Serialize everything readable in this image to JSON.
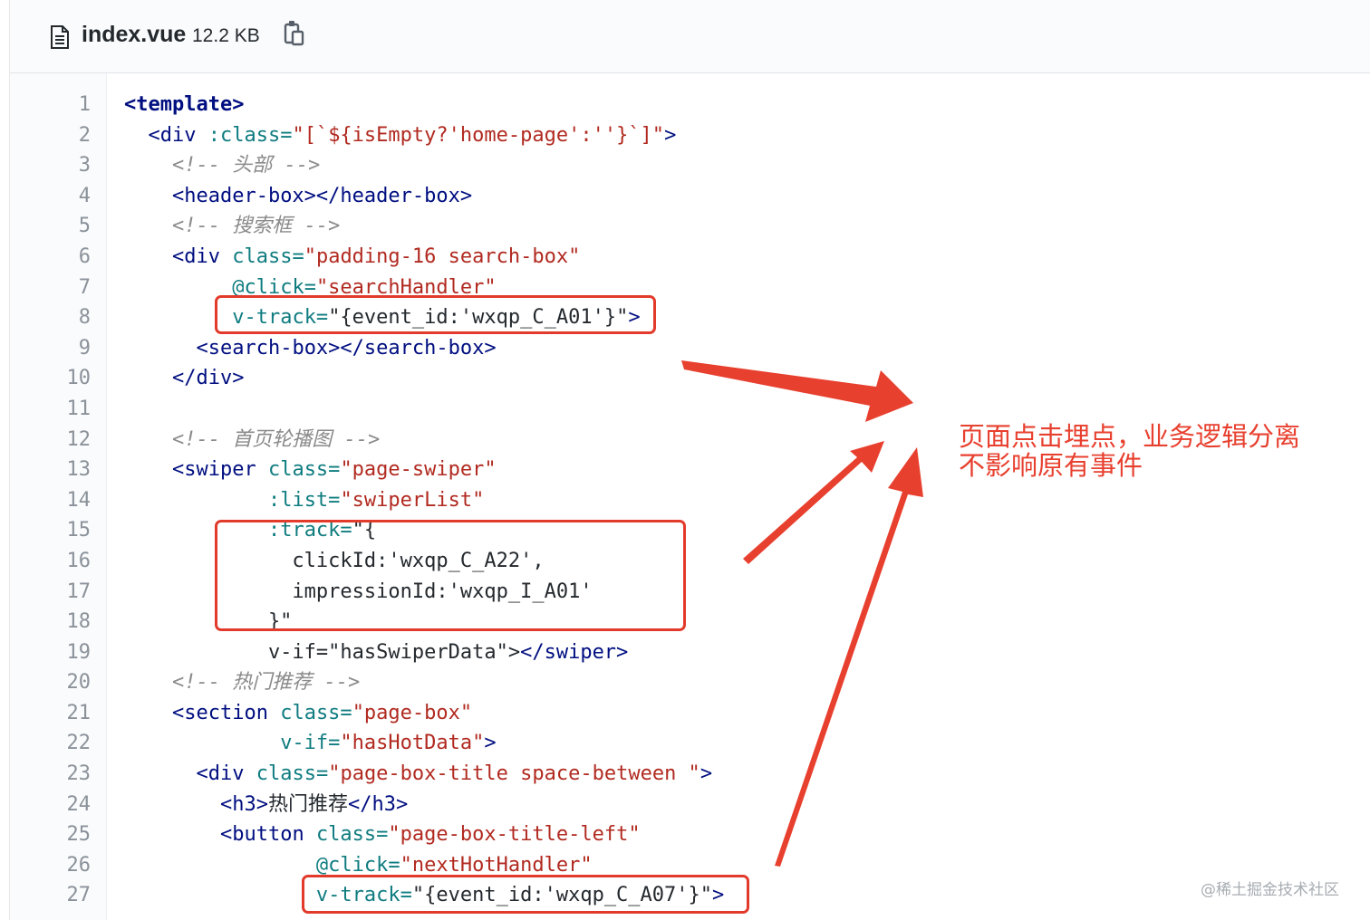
{
  "file_header": {
    "file_name": "index.vue",
    "file_size": "12.2 KB",
    "file_icon": "file-text-icon",
    "copy_icon": "clipboard-copy-icon"
  },
  "colors": {
    "tag": "#000e80",
    "attribute": "#0f7c80",
    "string": "#b12a20",
    "comment": "#8a8a8a",
    "highlight": "#e23a2b"
  },
  "code": {
    "line_numbers": [
      "1",
      "2",
      "3",
      "4",
      "5",
      "6",
      "7",
      "8",
      "9",
      "10",
      "11",
      "12",
      "13",
      "14",
      "15",
      "16",
      "17",
      "18",
      "19",
      "20",
      "21",
      "22",
      "23",
      "24",
      "25",
      "26",
      "27"
    ],
    "lines": [
      [
        {
          "t": "<template>",
          "k": "ktag"
        }
      ],
      [
        {
          "t": "  "
        },
        {
          "t": "<div",
          "k": "tag"
        },
        {
          "t": " "
        },
        {
          "t": ":class=",
          "k": "attr"
        },
        {
          "t": "\"[`${isEmpty?'home-page':''}`]\"",
          "k": "str"
        },
        {
          "t": ">",
          "k": "tag"
        }
      ],
      [
        {
          "t": "    "
        },
        {
          "t": "<!-- 头部 -->",
          "k": "cmt"
        }
      ],
      [
        {
          "t": "    "
        },
        {
          "t": "<header-box></header-box>",
          "k": "tag"
        }
      ],
      [
        {
          "t": "    "
        },
        {
          "t": "<!-- 搜索框 -->",
          "k": "cmt"
        }
      ],
      [
        {
          "t": "    "
        },
        {
          "t": "<div",
          "k": "tag"
        },
        {
          "t": " "
        },
        {
          "t": "class=",
          "k": "attr"
        },
        {
          "t": "\"padding-16 search-box\"",
          "k": "str"
        }
      ],
      [
        {
          "t": "         "
        },
        {
          "t": "@click=",
          "k": "attr"
        },
        {
          "t": "\"searchHandler\"",
          "k": "str"
        }
      ],
      [
        {
          "t": "         "
        },
        {
          "t": "v-track=",
          "k": "attr"
        },
        {
          "t": "\"{event_id:'wxqp_C_A01'}\"",
          "k": "txt"
        },
        {
          "t": ">",
          "k": "tag"
        }
      ],
      [
        {
          "t": "      "
        },
        {
          "t": "<search-box></search-box>",
          "k": "tag"
        }
      ],
      [
        {
          "t": "    "
        },
        {
          "t": "</div>",
          "k": "tag"
        }
      ],
      [
        {
          "t": ""
        }
      ],
      [
        {
          "t": "    "
        },
        {
          "t": "<!-- 首页轮播图 -->",
          "k": "cmt"
        }
      ],
      [
        {
          "t": "    "
        },
        {
          "t": "<swiper",
          "k": "tag"
        },
        {
          "t": " "
        },
        {
          "t": "class=",
          "k": "attr"
        },
        {
          "t": "\"page-swiper\"",
          "k": "str"
        }
      ],
      [
        {
          "t": "            "
        },
        {
          "t": ":list=",
          "k": "attr"
        },
        {
          "t": "\"swiperList\"",
          "k": "str"
        }
      ],
      [
        {
          "t": "            "
        },
        {
          "t": ":track=",
          "k": "attr"
        },
        {
          "t": "\"{",
          "k": "txt"
        }
      ],
      [
        {
          "t": "              clickId:'wxqp_C_A22',",
          "k": "txt"
        }
      ],
      [
        {
          "t": "              impressionId:'wxqp_I_A01'",
          "k": "txt"
        }
      ],
      [
        {
          "t": "            }\"",
          "k": "txt"
        }
      ],
      [
        {
          "t": "            v-if=\"hasSwiperData\">",
          "k": "txt"
        },
        {
          "t": "</swiper>",
          "k": "tag"
        }
      ],
      [
        {
          "t": "    "
        },
        {
          "t": "<!-- 热门推荐 -->",
          "k": "cmt"
        }
      ],
      [
        {
          "t": "    "
        },
        {
          "t": "<section",
          "k": "tag"
        },
        {
          "t": " "
        },
        {
          "t": "class=",
          "k": "attr"
        },
        {
          "t": "\"page-box\"",
          "k": "str"
        }
      ],
      [
        {
          "t": "             "
        },
        {
          "t": "v-if=",
          "k": "attr"
        },
        {
          "t": "\"hasHotData\"",
          "k": "str"
        },
        {
          "t": ">",
          "k": "tag"
        }
      ],
      [
        {
          "t": "      "
        },
        {
          "t": "<div",
          "k": "tag"
        },
        {
          "t": " "
        },
        {
          "t": "class=",
          "k": "attr"
        },
        {
          "t": "\"page-box-title space-between \"",
          "k": "str"
        },
        {
          "t": ">",
          "k": "tag"
        }
      ],
      [
        {
          "t": "        "
        },
        {
          "t": "<h3>",
          "k": "tag"
        },
        {
          "t": "热门推荐",
          "k": "txt"
        },
        {
          "t": "</h3>",
          "k": "tag"
        }
      ],
      [
        {
          "t": "        "
        },
        {
          "t": "<button",
          "k": "tag"
        },
        {
          "t": " "
        },
        {
          "t": "class=",
          "k": "attr"
        },
        {
          "t": "\"page-box-title-left\"",
          "k": "str"
        }
      ],
      [
        {
          "t": "                "
        },
        {
          "t": "@click=",
          "k": "attr"
        },
        {
          "t": "\"nextHotHandler\"",
          "k": "str"
        }
      ],
      [
        {
          "t": "                "
        },
        {
          "t": "v-track=",
          "k": "attr"
        },
        {
          "t": "\"{event_id:'wxqp_C_A07'}\"",
          "k": "txt"
        },
        {
          "t": ">",
          "k": "tag"
        }
      ]
    ]
  },
  "annotation": {
    "line1": "页面点击埋点，业务逻辑分离",
    "line2": "不影响原有事件"
  },
  "watermark": "@稀土掘金技术社区"
}
